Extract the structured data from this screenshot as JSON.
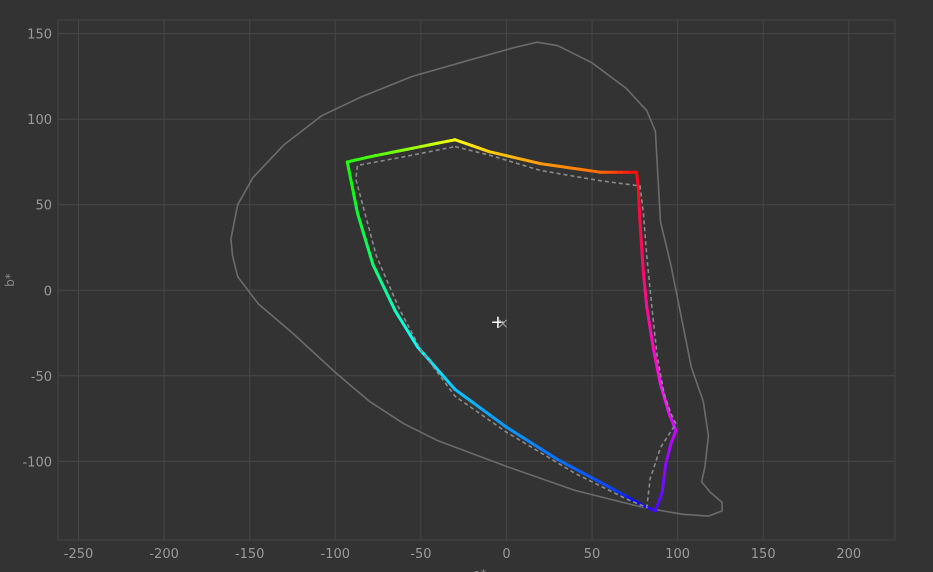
{
  "chart_data": {
    "type": "line",
    "title": "",
    "xlabel": "a*",
    "ylabel": "b*",
    "xlim": [
      -262,
      227
    ],
    "ylim": [
      -146,
      158
    ],
    "xticks": [
      -250,
      -200,
      -150,
      -100,
      -50,
      0,
      50,
      100,
      150,
      200
    ],
    "yticks": [
      150,
      100,
      50,
      0,
      -50,
      -100
    ],
    "grid": true,
    "colors": {
      "background": "#333333",
      "grid": "#474747",
      "outline": "#6b6b6b",
      "reference_dashed": "#8a8a8a"
    },
    "series": [
      {
        "style": "solid-gray",
        "points": [
          [
            -160,
            20
          ],
          [
            -161,
            30
          ],
          [
            -157,
            50
          ],
          [
            -148,
            66
          ],
          [
            -130,
            85
          ],
          [
            -108,
            102
          ],
          [
            -85,
            113
          ],
          [
            -55,
            125
          ],
          [
            -20,
            135
          ],
          [
            5,
            142
          ],
          [
            18,
            145
          ],
          [
            30,
            143
          ],
          [
            50,
            133
          ],
          [
            70,
            118
          ],
          [
            82,
            105
          ],
          [
            87,
            93
          ],
          [
            88,
            75
          ],
          [
            90,
            40
          ],
          [
            96,
            15
          ],
          [
            103,
            -20
          ],
          [
            108,
            -45
          ],
          [
            115,
            -65
          ],
          [
            118,
            -85
          ],
          [
            116,
            -103
          ],
          [
            114,
            -112
          ],
          [
            119,
            -118
          ],
          [
            126,
            -124
          ],
          [
            126,
            -129
          ],
          [
            118,
            -132
          ],
          [
            103,
            -131
          ],
          [
            80,
            -127
          ],
          [
            40,
            -117
          ],
          [
            0,
            -103
          ],
          [
            -40,
            -88
          ],
          [
            -60,
            -78
          ],
          [
            -80,
            -65
          ],
          [
            -100,
            -48
          ],
          [
            -125,
            -25
          ],
          [
            -145,
            -8
          ],
          [
            -157,
            8
          ],
          [
            -160,
            20
          ]
        ]
      },
      {
        "style": "gradient-hue",
        "points": [
          [
            -30,
            88
          ],
          [
            -10,
            81
          ],
          [
            20,
            74
          ],
          [
            55,
            69
          ],
          [
            76,
            69
          ],
          [
            77,
            60
          ],
          [
            78,
            40
          ],
          [
            80,
            10
          ],
          [
            82,
            -10
          ],
          [
            86,
            -35
          ],
          [
            90,
            -55
          ],
          [
            95,
            -72
          ],
          [
            99,
            -82
          ],
          [
            96,
            -90
          ],
          [
            93,
            -102
          ],
          [
            91,
            -118
          ],
          [
            87,
            -129
          ],
          [
            80,
            -126
          ],
          [
            60,
            -115
          ],
          [
            30,
            -99
          ],
          [
            0,
            -80
          ],
          [
            -30,
            -58
          ],
          [
            -52,
            -33
          ],
          [
            -65,
            -12
          ],
          [
            -78,
            15
          ],
          [
            -87,
            45
          ],
          [
            -93,
            75
          ],
          [
            -80,
            78
          ],
          [
            -60,
            82
          ],
          [
            -30,
            88
          ]
        ],
        "hues": [
          60,
          48,
          36,
          24,
          0,
          355,
          345,
          335,
          325,
          315,
          305,
          295,
          285,
          280,
          272,
          265,
          255,
          245,
          225,
          215,
          205,
          195,
          180,
          165,
          145,
          130,
          115,
          105,
          90,
          60
        ]
      },
      {
        "style": "dashed-gray",
        "points": [
          [
            -30,
            84
          ],
          [
            -10,
            79
          ],
          [
            20,
            70
          ],
          [
            55,
            64
          ],
          [
            78,
            61
          ],
          [
            80,
            45
          ],
          [
            82,
            20
          ],
          [
            85,
            -10
          ],
          [
            88,
            -38
          ],
          [
            92,
            -60
          ],
          [
            96,
            -72
          ],
          [
            99,
            -78
          ],
          [
            90,
            -92
          ],
          [
            84,
            -110
          ],
          [
            82,
            -127
          ],
          [
            70,
            -122
          ],
          [
            40,
            -107
          ],
          [
            0,
            -83
          ],
          [
            -30,
            -62
          ],
          [
            -50,
            -35
          ],
          [
            -63,
            -10
          ],
          [
            -76,
            20
          ],
          [
            -88,
            65
          ],
          [
            -87,
            73
          ],
          [
            -60,
            78
          ],
          [
            -30,
            84
          ]
        ]
      }
    ],
    "markers": [
      {
        "symbol": "+",
        "x": -5,
        "y": -19,
        "color": "#ffffff"
      },
      {
        "symbol": "×",
        "x": -2,
        "y": -19,
        "color": "#9a9a9a"
      }
    ]
  }
}
